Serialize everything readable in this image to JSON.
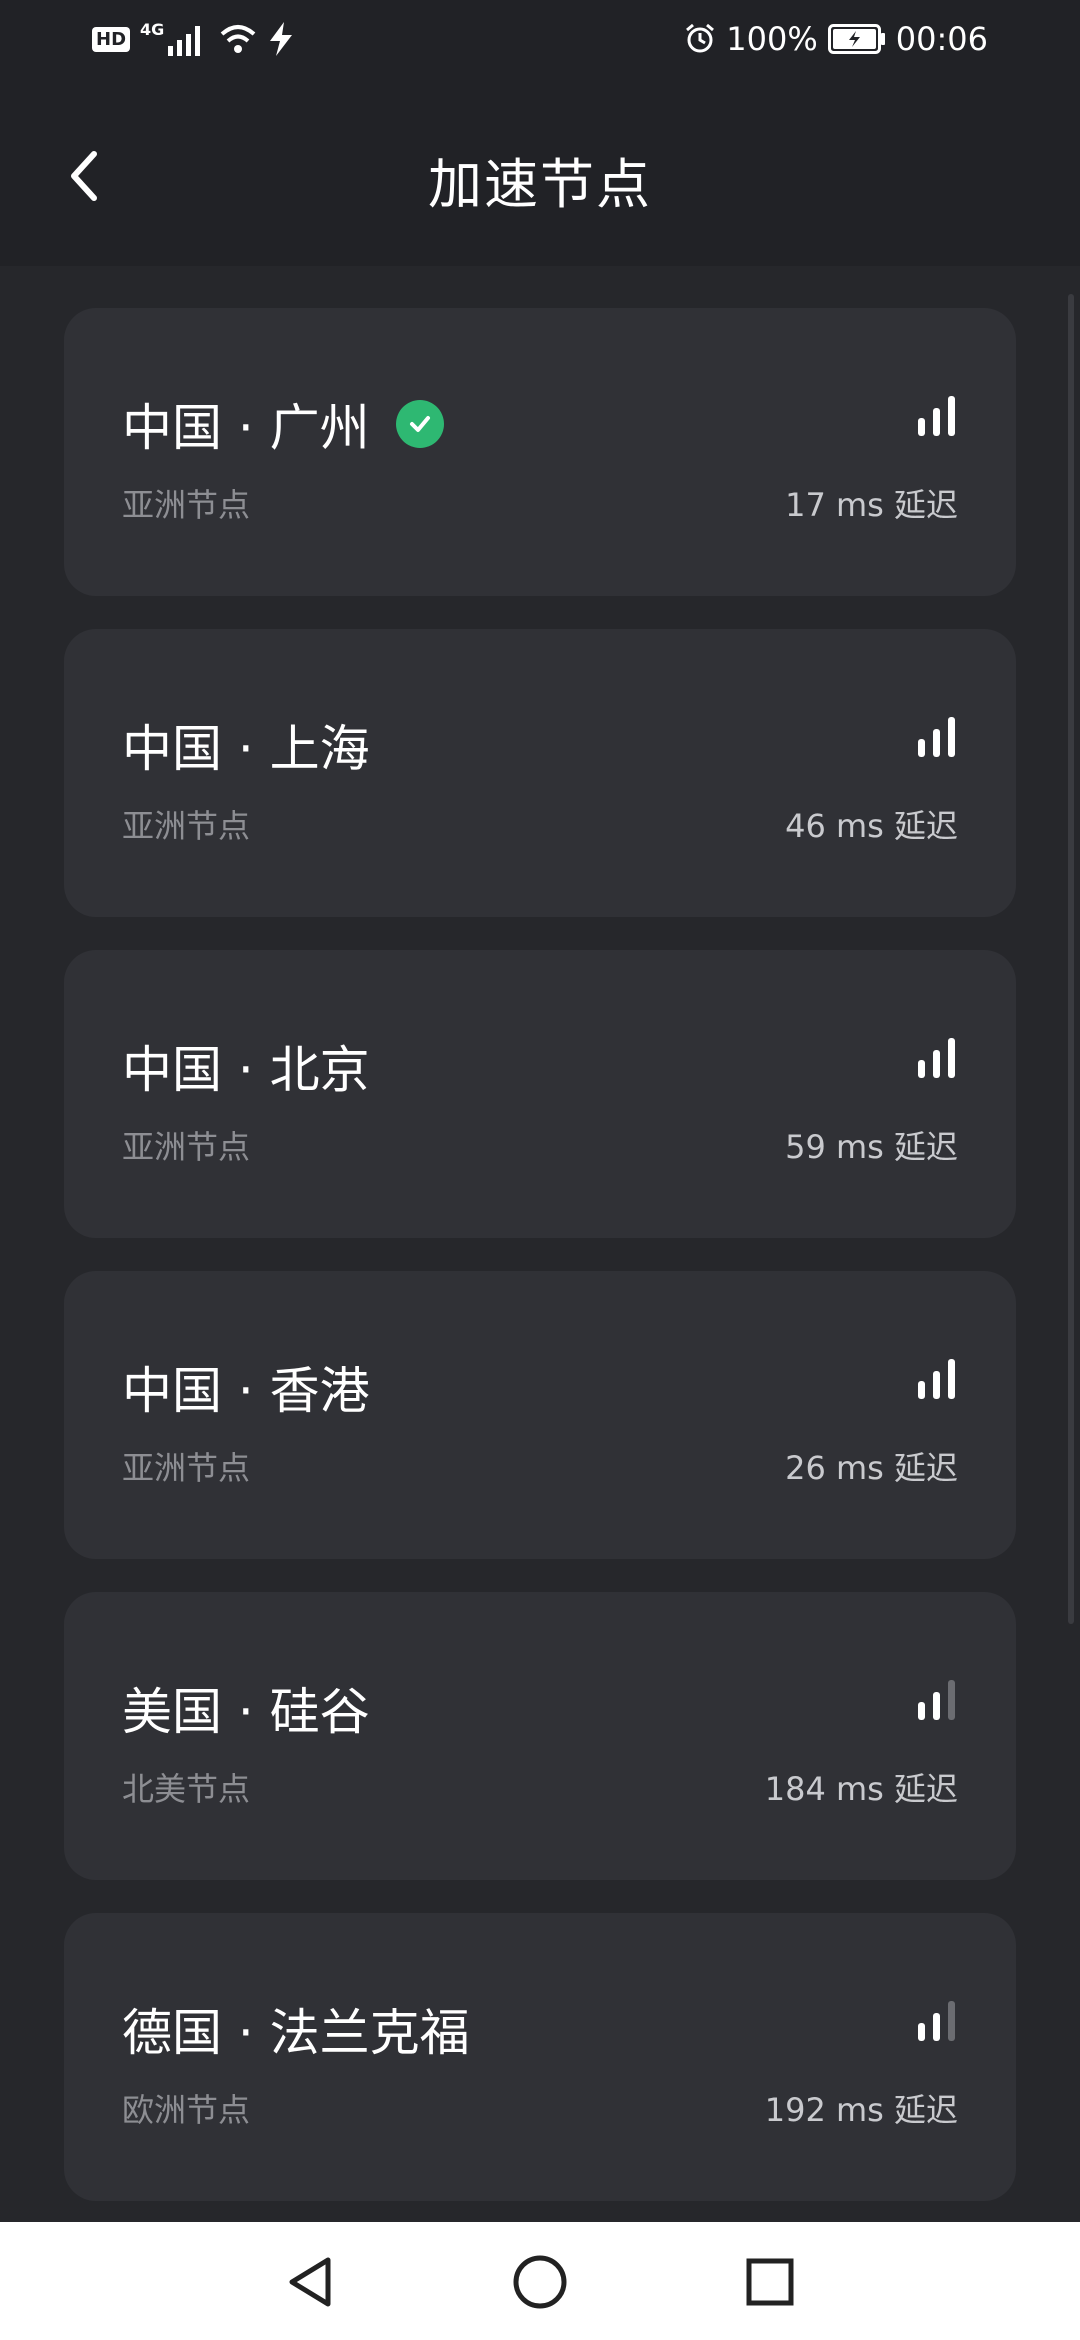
{
  "status_bar": {
    "network_type": "4G",
    "battery": "100%",
    "time": "00:06"
  },
  "header": {
    "title": "加速节点"
  },
  "nodes": [
    {
      "name": "中国 · 广州",
      "region": "亚洲节点",
      "latency": "17 ms 延迟",
      "selected": true,
      "signal_bars": 3
    },
    {
      "name": "中国 · 上海",
      "region": "亚洲节点",
      "latency": "46 ms 延迟",
      "selected": false,
      "signal_bars": 3
    },
    {
      "name": "中国 · 北京",
      "region": "亚洲节点",
      "latency": "59 ms 延迟",
      "selected": false,
      "signal_bars": 3
    },
    {
      "name": "中国 · 香港",
      "region": "亚洲节点",
      "latency": "26 ms 延迟",
      "selected": false,
      "signal_bars": 3
    },
    {
      "name": "美国 · 硅谷",
      "region": "北美节点",
      "latency": "184 ms 延迟",
      "selected": false,
      "signal_bars": 2
    },
    {
      "name": "德国 · 法兰克福",
      "region": "欧洲节点",
      "latency": "192 ms 延迟",
      "selected": false,
      "signal_bars": 2
    }
  ],
  "colors": {
    "background": "#26272b",
    "card": "#303136",
    "selected_check": "#2eb872",
    "signal_active": "#ffffff",
    "signal_inactive": "#6b6c71"
  }
}
